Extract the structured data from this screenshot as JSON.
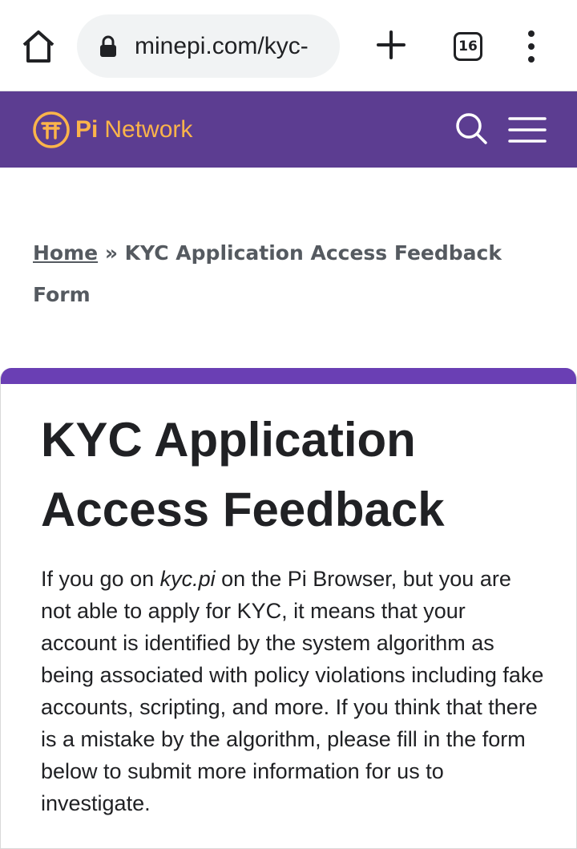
{
  "browser": {
    "url": "minepi.com/kyc-",
    "tab_count": "16"
  },
  "site": {
    "brand_pi": "Pi",
    "brand_name": "Network",
    "header_color": "#5c3d91",
    "logo_color": "#fbb44a"
  },
  "breadcrumb": {
    "home": "Home",
    "separator": " » ",
    "current": "KYC Application Access Feedback Form"
  },
  "page": {
    "title": "KYC Application Access Feedback",
    "intro_before": "If you go on ",
    "intro_emphasis": "kyc.pi",
    "intro_after": " on the Pi Browser, but you are not able to apply for KYC, it means that your account is identified by the system algorithm as being associated with policy violations including fake accounts, scripting, and more. If you think that there is a mistake by the algorithm, please fill in the form below to submit more information for us to investigate."
  }
}
